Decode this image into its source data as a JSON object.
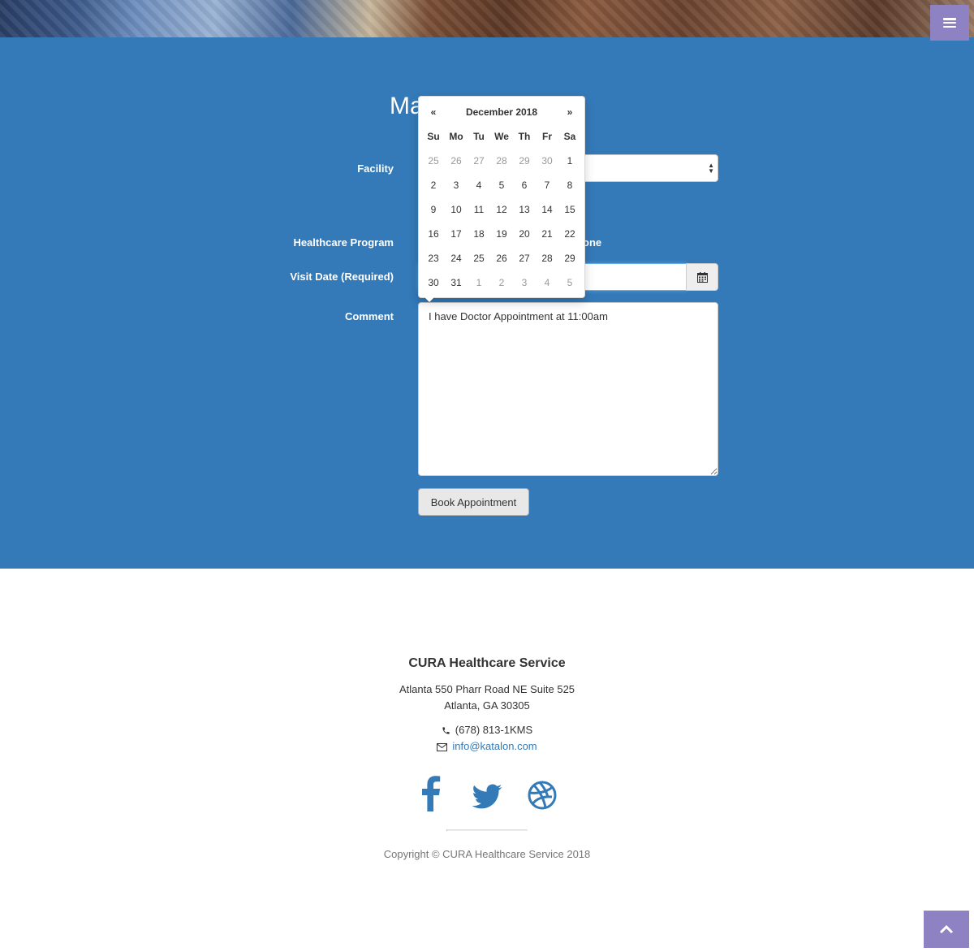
{
  "hero": {
    "menu_icon": "bars-icon"
  },
  "appointment": {
    "title_fragment": "Ma",
    "facility": {
      "label": "Facility"
    },
    "program": {
      "label": "Healthcare Program",
      "visible_option_fragment": "one"
    },
    "visit_date": {
      "label": "Visit Date (Required)",
      "placeholder": "dd/mm/yyyy"
    },
    "comment": {
      "label": "Comment",
      "value": "I have Doctor Appointment at 11:00am"
    },
    "book_button": "Book Appointment"
  },
  "datepicker": {
    "prev": "«",
    "next": "»",
    "month_label": "December 2018",
    "weekdays": [
      "Su",
      "Mo",
      "Tu",
      "We",
      "Th",
      "Fr",
      "Sa"
    ],
    "weeks": [
      [
        {
          "d": "25",
          "muted": true
        },
        {
          "d": "26",
          "muted": true
        },
        {
          "d": "27",
          "muted": true
        },
        {
          "d": "28",
          "muted": true
        },
        {
          "d": "29",
          "muted": true
        },
        {
          "d": "30",
          "muted": true
        },
        {
          "d": "1",
          "muted": false
        }
      ],
      [
        {
          "d": "2",
          "muted": false
        },
        {
          "d": "3",
          "muted": false
        },
        {
          "d": "4",
          "muted": false
        },
        {
          "d": "5",
          "muted": false
        },
        {
          "d": "6",
          "muted": false
        },
        {
          "d": "7",
          "muted": false
        },
        {
          "d": "8",
          "muted": false
        }
      ],
      [
        {
          "d": "9",
          "muted": false
        },
        {
          "d": "10",
          "muted": false
        },
        {
          "d": "11",
          "muted": false
        },
        {
          "d": "12",
          "muted": false
        },
        {
          "d": "13",
          "muted": false
        },
        {
          "d": "14",
          "muted": false
        },
        {
          "d": "15",
          "muted": false
        }
      ],
      [
        {
          "d": "16",
          "muted": false
        },
        {
          "d": "17",
          "muted": false
        },
        {
          "d": "18",
          "muted": false
        },
        {
          "d": "19",
          "muted": false
        },
        {
          "d": "20",
          "muted": false
        },
        {
          "d": "21",
          "muted": false
        },
        {
          "d": "22",
          "muted": false
        }
      ],
      [
        {
          "d": "23",
          "muted": false
        },
        {
          "d": "24",
          "muted": false
        },
        {
          "d": "25",
          "muted": false
        },
        {
          "d": "26",
          "muted": false
        },
        {
          "d": "27",
          "muted": false
        },
        {
          "d": "28",
          "muted": false
        },
        {
          "d": "29",
          "muted": false
        }
      ],
      [
        {
          "d": "30",
          "muted": false
        },
        {
          "d": "31",
          "muted": false
        },
        {
          "d": "1",
          "muted": true
        },
        {
          "d": "2",
          "muted": true
        },
        {
          "d": "3",
          "muted": true
        },
        {
          "d": "4",
          "muted": true
        },
        {
          "d": "5",
          "muted": true
        }
      ]
    ]
  },
  "footer": {
    "title": "CURA Healthcare Service",
    "address_line1": "Atlanta 550 Pharr Road NE Suite 525",
    "address_line2": "Atlanta, GA 30305",
    "phone": "(678) 813-1KMS",
    "email": "info@katalon.com",
    "socials": [
      "facebook-icon",
      "twitter-icon",
      "dribbble-icon"
    ],
    "copyright": "Copyright © CURA Healthcare Service 2018"
  },
  "colors": {
    "primary_blue": "#3479b8",
    "accent_purple": "#8e82c2",
    "link_blue": "#337ab7"
  }
}
